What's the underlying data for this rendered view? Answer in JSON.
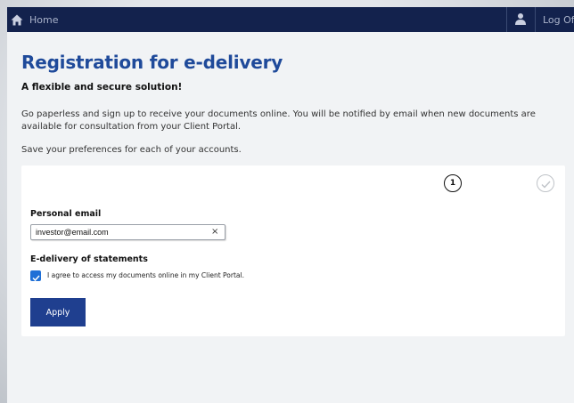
{
  "header": {
    "home_label": "Home",
    "home_icon": "home-icon",
    "user_icon": "user-icon",
    "logout_label": "Log Off",
    "bg_color": "#13224d"
  },
  "page": {
    "title": "Registration for e-delivery",
    "subtitle": "A flexible and secure solution!",
    "intro": "Go paperless and sign up to receive your documents online. You will be notified by email when new documents are available for consultation from your Client Portal.",
    "save_prefs": "Save your preferences for each of your accounts.",
    "title_color": "#1f4a9a"
  },
  "stepper": {
    "step1": "1",
    "step2_icon": "check-icon"
  },
  "form": {
    "email_label": "Personal email",
    "email_value": "investor@email.com",
    "clear_label": "×",
    "edelivery_label": "E-delivery of statements",
    "agree_label": "I agree to access my documents online in my Client Portal.",
    "agree_checked": true,
    "apply_label": "Apply",
    "button_color": "#1f3f8f",
    "checkbox_color": "#1f6fd6"
  }
}
